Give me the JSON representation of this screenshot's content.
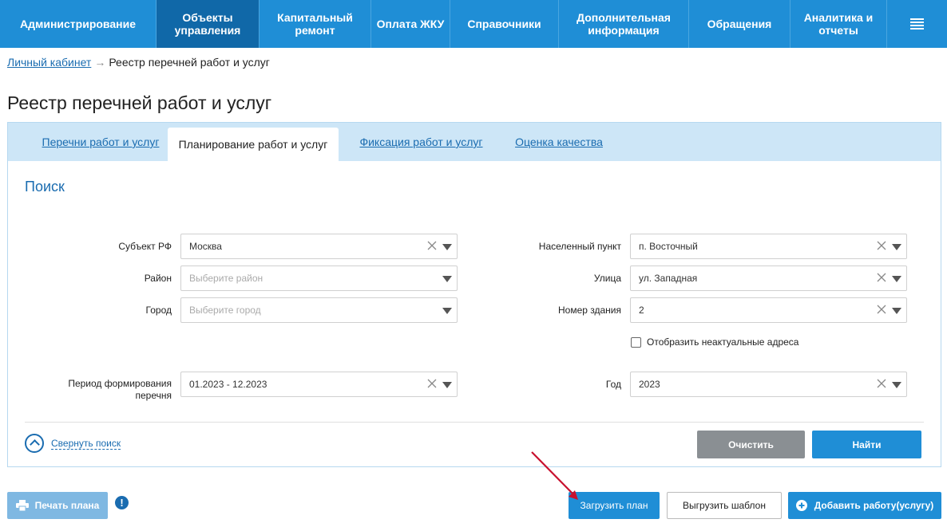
{
  "nav": {
    "items": [
      {
        "label": "Администрирование"
      },
      {
        "label": "Объекты\nуправления"
      },
      {
        "label": "Капитальный\nремонт"
      },
      {
        "label": "Оплата ЖКУ"
      },
      {
        "label": "Справочники"
      },
      {
        "label": "Дополнительная\nинформация"
      },
      {
        "label": "Обращения"
      },
      {
        "label": "Аналитика и\nотчеты"
      }
    ],
    "menu_icon": "hamburger-menu-icon"
  },
  "breadcrumb": {
    "home": "Личный кабинет",
    "separator": "→",
    "current": "Реестр перечней работ и услуг"
  },
  "page": {
    "title": "Реестр перечней работ и услуг"
  },
  "tabs": [
    {
      "label": "Перечни работ и услуг"
    },
    {
      "label": "Планирование работ и услуг"
    },
    {
      "label": "Фиксация работ и услуг"
    },
    {
      "label": "Оценка качества"
    }
  ],
  "search": {
    "title": "Поиск",
    "fields": {
      "subject": {
        "label": "Субъект РФ",
        "value": "Москва"
      },
      "district": {
        "label": "Район",
        "placeholder": "Выберите район"
      },
      "city": {
        "label": "Город",
        "placeholder": "Выберите город"
      },
      "settlement": {
        "label": "Населенный пункт",
        "value": "п. Восточный"
      },
      "street": {
        "label": "Улица",
        "value": "ул. Западная"
      },
      "building": {
        "label": "Номер здания",
        "value": "2"
      },
      "period": {
        "label": "Период формирования\nперечня",
        "value": "01.2023 - 12.2023"
      },
      "year": {
        "label": "Год",
        "value": "2023"
      }
    },
    "show_inactive": "Отобразить неактуальные адреса",
    "collapse": "Свернуть поиск",
    "clear_button": "Очистить",
    "find_button": "Найти"
  },
  "actions": {
    "print": "Печать плана",
    "info": "!",
    "upload": "Загрузить план",
    "download_template": "Выгрузить шаблон",
    "add_work": "Добавить работу(услугу)"
  },
  "colors": {
    "nav_bg": "#1f8ed6",
    "nav_active": "#1068a8",
    "link": "#1a6cb0",
    "tabbar": "#cde6f7",
    "annotation_arrow": "#c8102e"
  }
}
